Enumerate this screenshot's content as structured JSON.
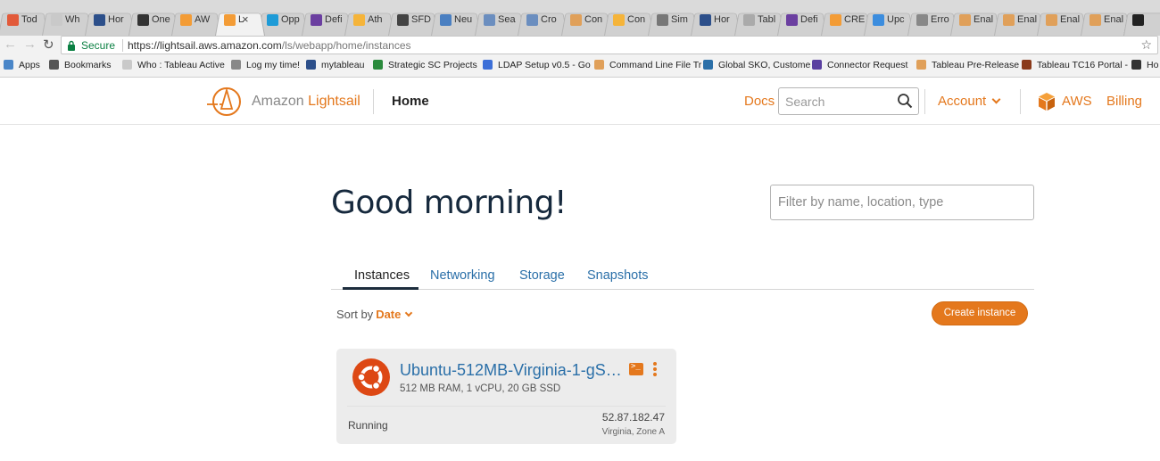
{
  "browser": {
    "tabs": [
      {
        "title": "Tod",
        "color": "#e25a3a"
      },
      {
        "title": "Wh",
        "color": "#c9c9c9"
      },
      {
        "title": "Hor",
        "color": "#2c4f8a"
      },
      {
        "title": "One",
        "color": "#333333"
      },
      {
        "title": "AW",
        "color": "#f39c36"
      },
      {
        "title": "L",
        "color": "#f39c36",
        "active": true
      },
      {
        "title": "Opp",
        "color": "#1e9bd7"
      },
      {
        "title": "Defi",
        "color": "#6b3fa0"
      },
      {
        "title": "Ath",
        "color": "#f5b43a"
      },
      {
        "title": "SFD",
        "color": "#444444"
      },
      {
        "title": "Neu",
        "color": "#4a7fc1"
      },
      {
        "title": "Sea",
        "color": "#6b8ebf"
      },
      {
        "title": "Cro",
        "color": "#6b8ebf"
      },
      {
        "title": "Con",
        "color": "#e0a05a"
      },
      {
        "title": "Con",
        "color": "#f5b43a"
      },
      {
        "title": "Sim",
        "color": "#777777"
      },
      {
        "title": "Hor",
        "color": "#2c4f8a"
      },
      {
        "title": "Tabl",
        "color": "#aaaaaa"
      },
      {
        "title": "Defi",
        "color": "#6b3fa0"
      },
      {
        "title": "CRE",
        "color": "#f39c36"
      },
      {
        "title": "Upc",
        "color": "#3c8dde"
      },
      {
        "title": "Erro",
        "color": "#888888"
      },
      {
        "title": "Enal",
        "color": "#e0a05a"
      },
      {
        "title": "Enal",
        "color": "#e0a05a"
      },
      {
        "title": "Enal",
        "color": "#e0a05a"
      },
      {
        "title": "Enal",
        "color": "#e0a05a"
      },
      {
        "title": "",
        "color": "#222222"
      }
    ],
    "secure_label": "Secure",
    "url_host": "https://lightsail.aws.amazon.com",
    "url_path": "/ls/webapp/home/instances",
    "bookmarks": [
      {
        "label": "Apps",
        "color": "#4a86c8"
      },
      {
        "label": "Bookmarks",
        "color": "#555555"
      },
      {
        "label": "Who : Tableau Active",
        "color": "#c9c9c9"
      },
      {
        "label": "Log my time!",
        "color": "#888888"
      },
      {
        "label": "mytableau",
        "color": "#2c4f8a"
      },
      {
        "label": "Strategic SC Projects",
        "color": "#2a8a3c"
      },
      {
        "label": "LDAP Setup v0.5 - Go",
        "color": "#3c6fd8"
      },
      {
        "label": "Command Line File Tr",
        "color": "#e0a05a"
      },
      {
        "label": "Global SKO, Custome",
        "color": "#2a6fa8"
      },
      {
        "label": "Connector Request",
        "color": "#5a3fa0"
      },
      {
        "label": "Tableau Pre-Release",
        "color": "#e0a05a"
      },
      {
        "label": "Tableau TC16 Portal -",
        "color": "#8a3a1a"
      },
      {
        "label": "Ho",
        "color": "#333333"
      }
    ]
  },
  "header": {
    "brand_prefix": "Amazon ",
    "brand_name": "Lightsail",
    "home": "Home",
    "docs": "Docs",
    "search_placeholder": "Search",
    "account": "Account",
    "aws": "AWS",
    "billing": "Billing",
    "accent_color": "#e4781d"
  },
  "main": {
    "greeting": "Good morning!",
    "filter_placeholder": "Filter by name, location, type",
    "tabs": [
      {
        "label": "Instances",
        "active": true
      },
      {
        "label": "Networking"
      },
      {
        "label": "Storage"
      },
      {
        "label": "Snapshots"
      }
    ],
    "sort_label": "Sort by",
    "sort_value": "Date",
    "create_button": "Create instance",
    "instances": [
      {
        "name": "Ubuntu-512MB-Virginia-1-gS…",
        "specs": "512 MB RAM, 1 vCPU, 20 GB SSD",
        "status": "Running",
        "ip": "52.87.182.47",
        "zone": "Virginia, Zone A",
        "icon": "ubuntu-icon",
        "terminal_glyph": ">_"
      }
    ]
  }
}
